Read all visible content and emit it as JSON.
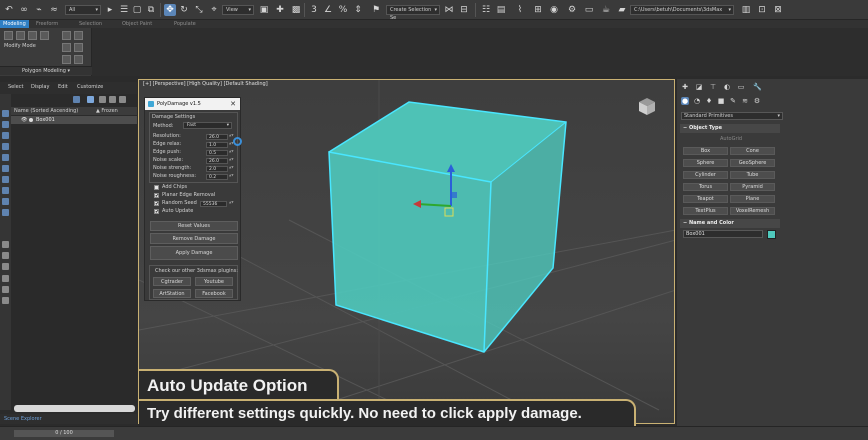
{
  "toolbar": {
    "filter_value": "All",
    "view_value": "View",
    "selection_set_placeholder": "Create Selection Se",
    "path_value": "C:\\Users\\betuh\\Documents\\3dsMax"
  },
  "ribbon": {
    "tabs": [
      "Modeling",
      "Freeform",
      "Selection",
      "Object Paint",
      "Populate"
    ],
    "modify_mode_label": "Modify Mode",
    "polygon_modeling_label": "Polygon Modeling ▾"
  },
  "scene_explorer": {
    "menu": [
      "Select",
      "Display",
      "Edit",
      "Customize"
    ],
    "column_name": "Name (Sorted Ascending)",
    "column_frozen": "▲ Frozen",
    "row_name": "Box001",
    "tab_label": "Scene Explorer",
    "frame_counter": "0 / 100"
  },
  "viewport": {
    "label": "[+] [Perspective] [High Quality] [Default Shading]",
    "object_color": "#4fc9bd",
    "edge_color": "#49e6ff",
    "accent_color": "#c9b173"
  },
  "dialog": {
    "title": "PolyDamage v1.5",
    "close": "✕",
    "group_label": "Damage Settings",
    "method_label": "Method:",
    "method_value": "Fast",
    "params": [
      {
        "label": "Resolution:",
        "value": "26.0"
      },
      {
        "label": "Edge relax:",
        "value": "1.0"
      },
      {
        "label": "Edge push:",
        "value": "0.5"
      },
      {
        "label": "Noise scale:",
        "value": "26.0"
      },
      {
        "label": "Noise strength:",
        "value": "2.0"
      },
      {
        "label": "Noise roughness:",
        "value": "0.2"
      }
    ],
    "checks": [
      {
        "label": "Add Chips",
        "checked": false
      },
      {
        "label": "Planar Edge Removal",
        "checked": true
      },
      {
        "label": "Random Seed",
        "checked": true,
        "value": "55536"
      },
      {
        "label": "Auto Update",
        "checked": true
      }
    ],
    "buttons": {
      "reset": "Reset Values",
      "remove": "Remove Damage",
      "apply": "Apply Damage"
    },
    "plugins_label": "Check our other 3dsmax plugins:",
    "plugin_buttons": [
      "Cgtrader",
      "Youtube",
      "ArtStation",
      "Facebook"
    ]
  },
  "caption": {
    "title": "Auto Update Option",
    "subtitle": "Try different settings quickly. No need to click apply damage."
  },
  "command_panel": {
    "dropdown": "Standard Primitives",
    "object_type_header": "Object Type",
    "autogrid": "AutoGrid",
    "object_buttons": [
      "Box",
      "Cone",
      "Sphere",
      "GeoSphere",
      "Cylinder",
      "Tube",
      "Torus",
      "Pyramid",
      "Teapot",
      "Plane",
      "TextPlus",
      "VoxelRemesh"
    ],
    "name_color_header": "Name and Color",
    "object_name": "Box001",
    "color": "#4fc9bd"
  }
}
